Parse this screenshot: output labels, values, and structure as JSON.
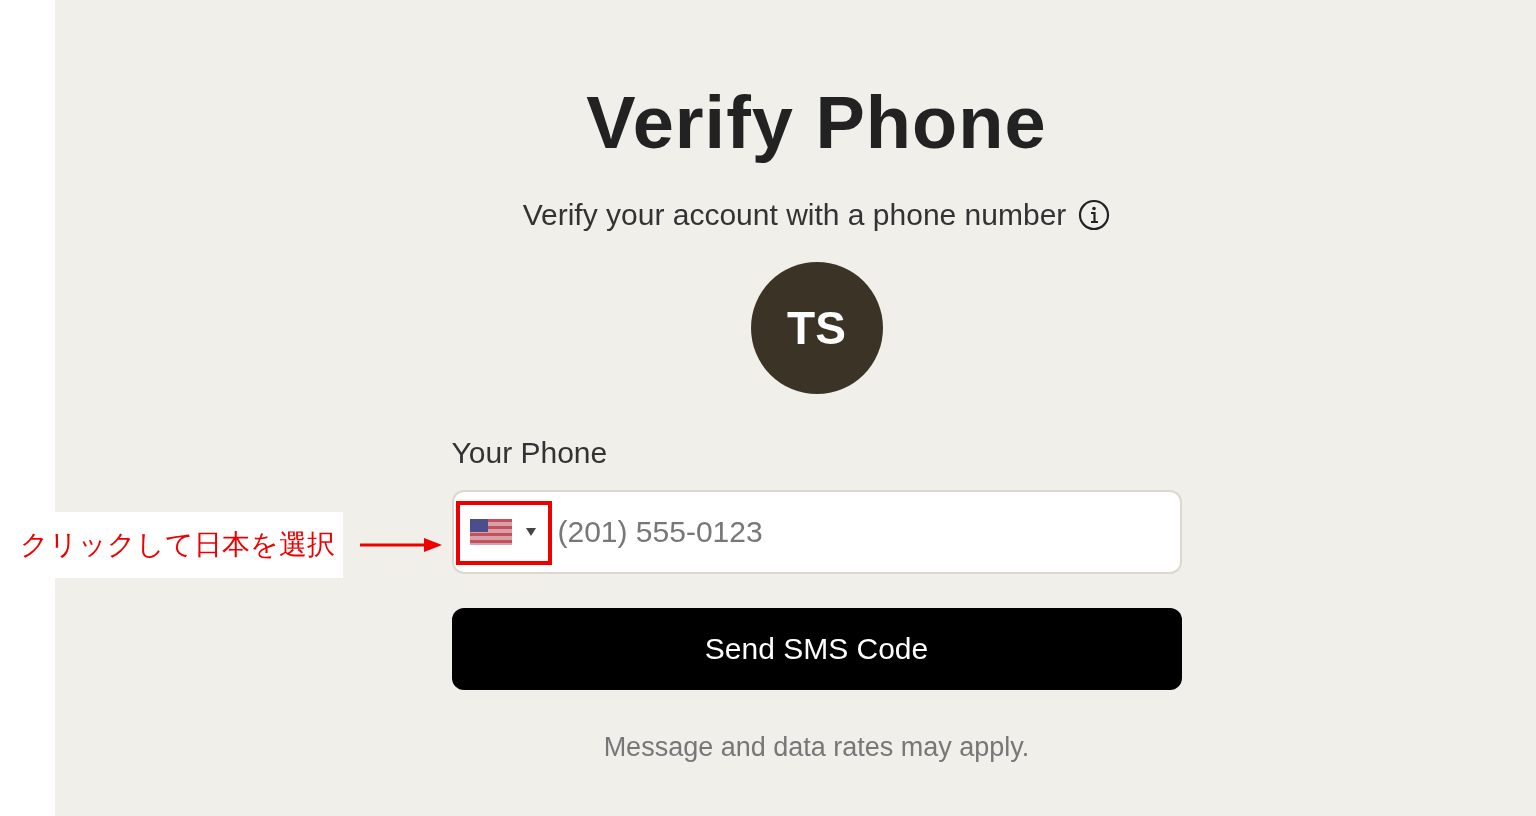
{
  "title": "Verify Phone",
  "subtitle": "Verify your account with a phone number",
  "avatar": {
    "initials": "TS"
  },
  "phone": {
    "label": "Your Phone",
    "placeholder": "(201) 555-0123"
  },
  "button": "Send SMS Code",
  "note": "Message and data rates may apply.",
  "annotation": {
    "text": "クリックして日本を選択"
  }
}
